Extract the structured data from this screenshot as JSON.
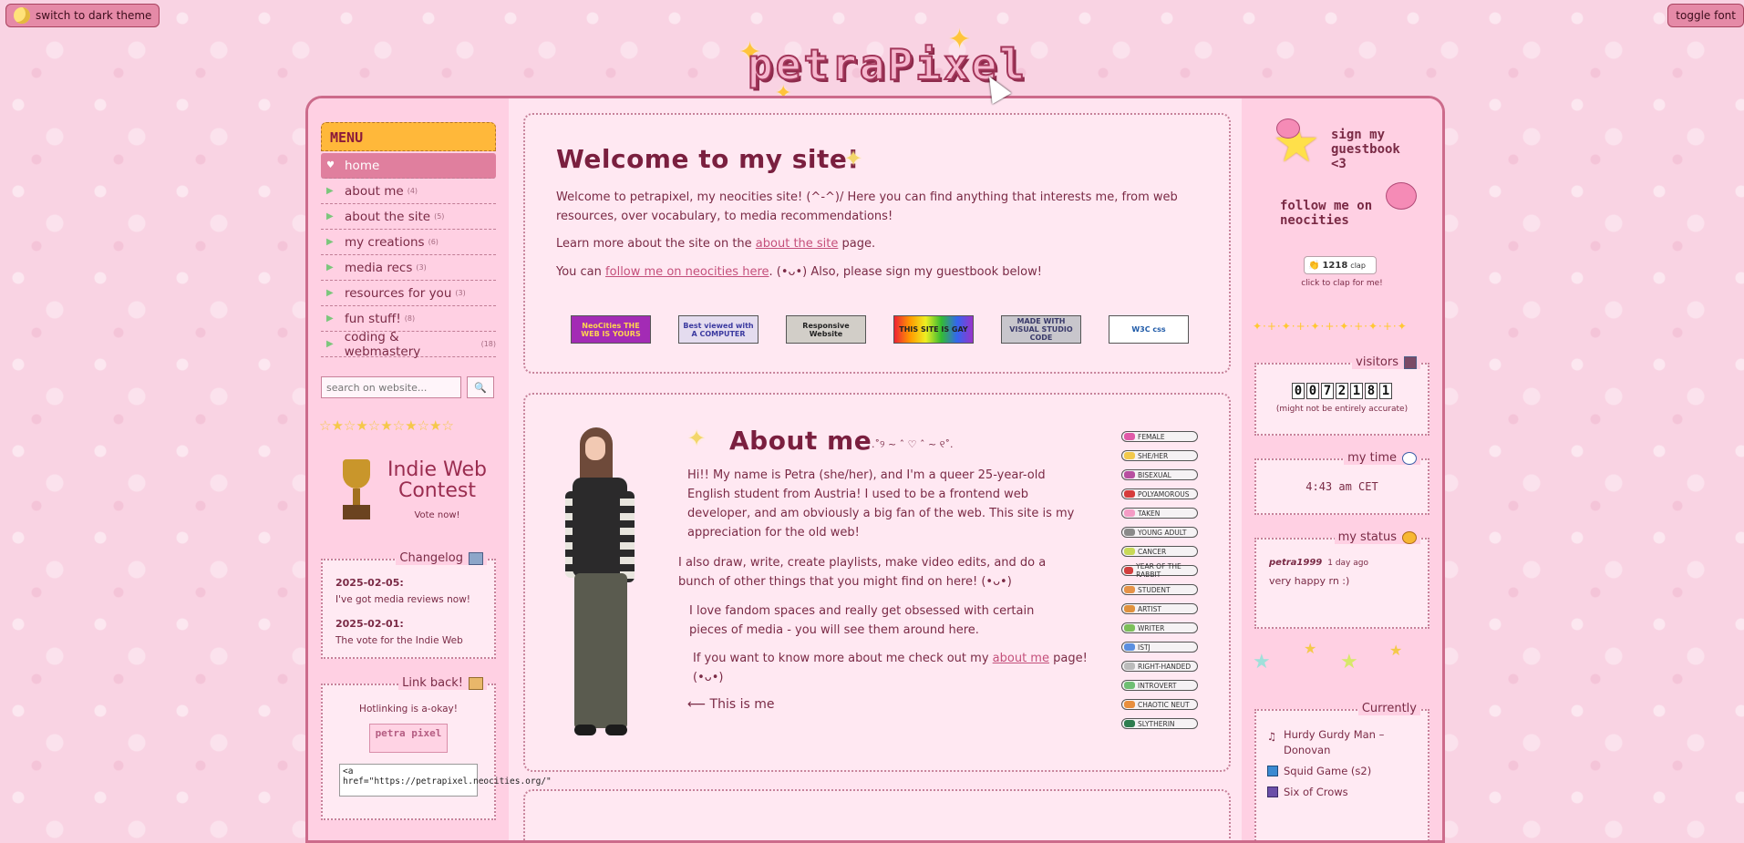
{
  "top_buttons": {
    "dark_theme": "switch to dark theme",
    "toggle_font": "toggle font"
  },
  "logo": {
    "text": "petraPixel"
  },
  "menu": {
    "title": "MENU",
    "items": [
      {
        "label": "home",
        "count": ""
      },
      {
        "label": "about me",
        "count": "(4)"
      },
      {
        "label": "about the site",
        "count": "(5)"
      },
      {
        "label": "my creations",
        "count": "(6)"
      },
      {
        "label": "media recs",
        "count": "(3)"
      },
      {
        "label": "resources for you",
        "count": "(3)"
      },
      {
        "label": "fun stuff!",
        "count": "(8)"
      },
      {
        "label": "coding & webmastery",
        "count": "(18)"
      }
    ]
  },
  "search": {
    "placeholder": "search on website...",
    "button": "🔍"
  },
  "contest": {
    "title": "Indie Web Contest",
    "vote": "Vote now!"
  },
  "changelog": {
    "title": "Changelog",
    "entries": [
      {
        "date": "2025-02-05:",
        "text": "I've got media reviews now!"
      },
      {
        "date": "2025-02-01:",
        "text": "The vote for the Indie Web"
      }
    ]
  },
  "linkback": {
    "title": "Link back!",
    "text": "Hotlinking is a-okay!",
    "button_text": "petra pixel",
    "code": "<a href=\"https://petrapixel.neocities.org/\""
  },
  "welcome": {
    "title": "Welcome to my site!",
    "p1a": "Welcome to petrapixel, my neocities site!",
    "kaomoji1": "(^-^)/",
    "p1b": "Here you can find anything that interests me, from web resources, over vocabulary, to media recommendations!",
    "p2a": "Learn more about the site on the",
    "p2link": "about the site",
    "p2b": "page.",
    "p3a": "You can",
    "p3link": "follow me on neocities here",
    "kaomoji2": "(•ᴗ•)",
    "p3b": "Also, please sign my guestbook below!",
    "badges": [
      "NeoCities THE WEB IS YOURS",
      "Best viewed with A COMPUTER",
      "Responsive Website",
      "THIS SITE IS GAY",
      "MADE WITH VISUAL STUDIO CODE",
      "W3C css"
    ]
  },
  "about": {
    "title": "About me",
    "title_deco": ".˚୨ ~ ˆ ♡ ˆ ~ ୧˚.",
    "p1": "Hi!! My name is Petra (she/her), and I'm a queer 25-year-old English student from Austria! I used to be a frontend web developer, and am obviously a big fan of the web. This site is my appreciation for the old web!",
    "p2": "I also draw, write, create playlists, make video edits, and do a bunch of other things that you might find on here!",
    "kaomoji3": "(•ᴗ•)",
    "p3": "I love fandom spaces and really get obsessed with certain pieces of media - you will see them around here.",
    "p4a": "If you want to know more about me check out my",
    "p4link": "about me",
    "p4b": "page!",
    "kaomoji4": "(•ᴗ•)",
    "arrow_text": "⟵ This is me",
    "tags": [
      {
        "label": "FEMALE",
        "color": "#e05aa8"
      },
      {
        "label": "SHE/HER",
        "color": "#f2c94c"
      },
      {
        "label": "BISEXUAL",
        "color": "#b74fa0"
      },
      {
        "label": "POLYAMOROUS",
        "color": "#d63b3b"
      },
      {
        "label": "TAKEN",
        "color": "#f59cc6"
      },
      {
        "label": "YOUNG ADULT",
        "color": "#8a8a8a"
      },
      {
        "label": "CANCER",
        "color": "#c8d957"
      },
      {
        "label": "YEAR OF THE RABBIT",
        "color": "#d13f3f"
      },
      {
        "label": "STUDENT",
        "color": "#e69348"
      },
      {
        "label": "ARTIST",
        "color": "#e0913d"
      },
      {
        "label": "WRITER",
        "color": "#7cbf5a"
      },
      {
        "label": "ISTJ",
        "color": "#5a8fe0"
      },
      {
        "label": "RIGHT-HANDED",
        "color": "#bbbbbb"
      },
      {
        "label": "INTROVERT",
        "color": "#6fbf73"
      },
      {
        "label": "CHAOTIC NEUT",
        "color": "#e88f3d"
      },
      {
        "label": "SLYTHERIN",
        "color": "#2e7d4f"
      }
    ]
  },
  "right": {
    "guestbook": "sign my guestbook <3",
    "follow": "follow me on neocities",
    "clap_count": "1218",
    "clap_word": "clap",
    "clap_caption": "click to clap for me!",
    "visitors_title": "visitors",
    "visitor_digits": [
      "0",
      "0",
      "7",
      "2",
      "1",
      "8",
      "1"
    ],
    "visitors_note": "(might not be entirely accurate)",
    "time_title": "my time",
    "time_value": "4:43 am CET",
    "status_title": "my status",
    "status_user": "petra1999",
    "status_ago": "1 day ago",
    "status_text": "very happy rn :)",
    "currently_title": "Currently",
    "currently": [
      {
        "text": "Hurdy Gurdy Man – Donovan",
        "icon": "music-note-icon"
      },
      {
        "text": "Squid Game (s2)",
        "icon": "tv-icon"
      },
      {
        "text": "Six of Crows",
        "icon": "book-icon"
      }
    ]
  }
}
